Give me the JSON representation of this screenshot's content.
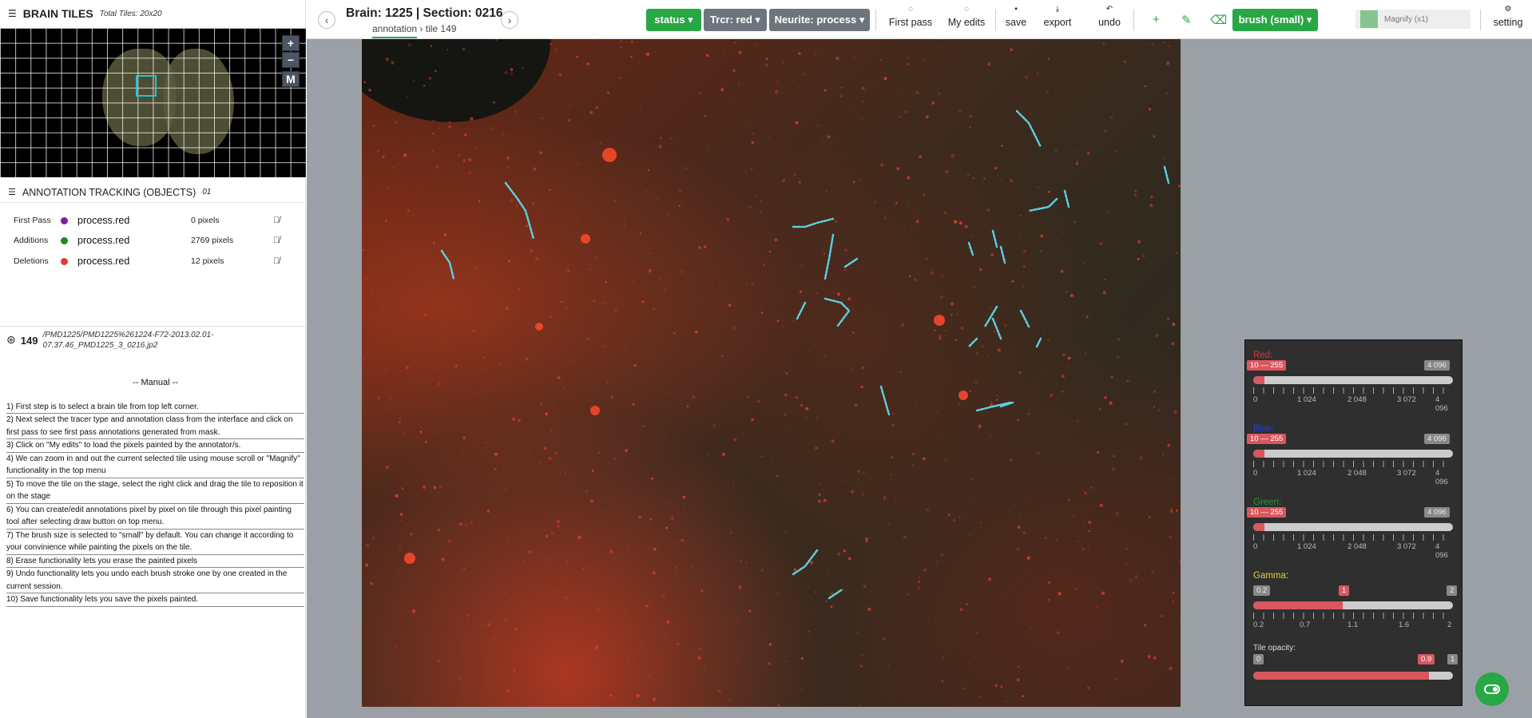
{
  "left": {
    "title": "BRAIN TILES",
    "total_tiles": "Total Tiles: 20x20",
    "zoom_in": "+",
    "zoom_out": "−",
    "mode_button": "M",
    "annotation_header": "ANNOTATION TRACKING (OBJECTS)",
    "annotation_count": "01",
    "annotations": [
      {
        "label": "First Pass",
        "color": "#7b1fa2",
        "class": "process.red",
        "pixels": "0 pixels"
      },
      {
        "label": "Additions",
        "color": "#1b8a1b",
        "class": "process.red",
        "pixels": "2769 pixels"
      },
      {
        "label": "Deletions",
        "color": "#e53935",
        "class": "process.red",
        "pixels": "12 pixels"
      }
    ],
    "tile_number": "149",
    "path": "/PMD1225/PMD1225%261224-F72-2013.02.01-07.37.46_PMD1225_3_0216.jp2",
    "manual_title": "-- Manual --",
    "manual": [
      "1) First step is to select a brain tile from top left corner.",
      "2) Next select the tracer type and annotation class from the interface and click on first pass to see first pass annotations generated from mask.",
      "3) Click on \"My edits\" to load the pixels painted by the annotator/s.",
      "4) We can zoom in and out the current selected tile using mouse scroll or \"Magnify\" functionality in the top menu",
      "5) To move the tile on the stage, select the right click and drag the tile to reposition it on the stage",
      "6) You can create/edit annotations pixel by pixel on tile through this pixel painting tool after selecting draw button on top menu.",
      "7) The brush size is selected to \"small\" by default. You can change it according to your convinience while painting the pixels on the tile.",
      "8) Erase functionality lets you erase the painted pixels",
      "9) Undo functionality lets you undo each brush stroke one by one created in the current session.",
      "10) Save functionality lets you save the pixels painted."
    ]
  },
  "top": {
    "title": "Brain: 1225 | Section: 0216",
    "crumb_1": "annotation",
    "crumb_sep": "›",
    "crumb_2": "tile 149",
    "prev": "‹",
    "next": "›",
    "status": "status ▾",
    "tracer": "Trcr: red ▾",
    "neurite": "Neurite: process ▾",
    "first_pass": "First pass",
    "my_edits": "My edits",
    "save": "save",
    "export": "export",
    "undo": "undo",
    "brush": "brush (small) ▾",
    "magnify": "Magnify (x1)",
    "setting": "setting"
  },
  "panel": {
    "red_label": "Red:",
    "red_range": "10 — 255",
    "red_max": "4 096",
    "blue_label": "Blue:",
    "blue_range": "10 — 255",
    "blue_max": "4 096",
    "green_label": "Green:",
    "green_range": "10 — 255",
    "green_max": "4 096",
    "ticks": [
      "0",
      "1 024",
      "2 048",
      "3 072",
      "4 096"
    ],
    "gamma_label": "Gamma:",
    "gamma_min": "0.2",
    "gamma_val": "1",
    "gamma_max": "2",
    "gamma_ticks": [
      "0.2",
      "0.7",
      "1.1",
      "1.6",
      "2"
    ],
    "opacity_label": "Tile opacity:",
    "opacity_min": "0",
    "opacity_val": "0.9",
    "opacity_max": "1"
  },
  "colors": {
    "accent": "#28a745",
    "slider": "#d9575e",
    "trace": "#5ccfe0"
  }
}
